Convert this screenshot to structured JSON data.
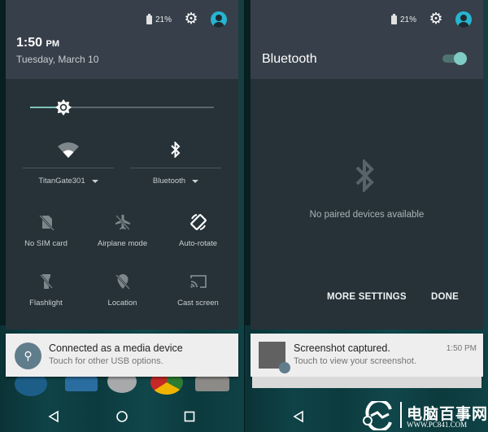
{
  "left_screen": {
    "status_bar": {
      "battery_percent": "21%",
      "settings_icon": "gear-icon",
      "user_icon": "account-circle-icon"
    },
    "clock": {
      "time": "1:50",
      "ampm": "PM",
      "date": "Tuesday, March 10"
    },
    "brightness": {
      "level": 0.18,
      "icon": "brightness-icon"
    },
    "quick_settings": {
      "wifi": {
        "label": "TitanGate301",
        "icon": "wifi-icon"
      },
      "bluetooth": {
        "label": "Bluetooth",
        "icon": "bluetooth-icon"
      },
      "tiles": [
        {
          "label": "No SIM card",
          "icon": "no-sim-icon",
          "active": false
        },
        {
          "label": "Airplane mode",
          "icon": "airplane-off-icon",
          "active": false
        },
        {
          "label": "Auto-rotate",
          "icon": "auto-rotate-icon",
          "active": true
        },
        {
          "label": "Flashlight",
          "icon": "flashlight-off-icon",
          "active": false
        },
        {
          "label": "Location",
          "icon": "location-off-icon",
          "active": false
        },
        {
          "label": "Cast screen",
          "icon": "cast-icon",
          "active": false
        }
      ]
    },
    "notification": {
      "title": "Connected as a media device",
      "text": "Touch for other USB options.",
      "icon": "usb-icon"
    }
  },
  "right_screen": {
    "status_bar": {
      "battery_percent": "21%",
      "settings_icon": "gear-icon",
      "user_icon": "account-circle-icon"
    },
    "bluetooth_panel": {
      "title": "Bluetooth",
      "enabled": true,
      "empty_message": "No paired devices available",
      "more_settings_label": "MORE SETTINGS",
      "done_label": "DONE"
    },
    "notification": {
      "title": "Screenshot captured.",
      "text": "Touch to view your screenshot.",
      "time": "1:50 PM"
    }
  },
  "watermark": {
    "name": "电脑百事网",
    "url": "WWW.PC841.COM"
  },
  "colors": {
    "panel_bg": "#263238",
    "header_bg": "#37404a",
    "accent": "#80cbc4",
    "avatar": "#26b5d1"
  }
}
